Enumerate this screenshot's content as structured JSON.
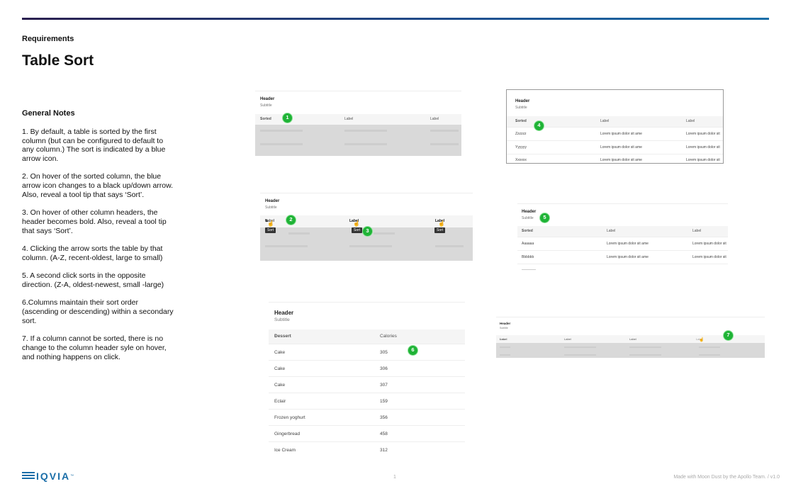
{
  "eyebrow": "Requirements",
  "title": "Table Sort",
  "notes": {
    "heading": "General Notes",
    "items": [
      "1. By default, a table is sorted by the first column (but can be configured to default to any column.) The sort is indicated by a blue arrow icon.",
      "2. On hover of the sorted column, the blue arrow icon changes to a black up/down arrow. Also, reveal a tool tip that says ‘Sort’.",
      "3. On hover of other column headers, the header becomes bold. Also, reveal a tool tip that says ‘Sort’.",
      "4. Clicking the arrow sorts the table by that column. (A-Z, recent-oldest, large to small)",
      "5. A second click sorts in the opposite direction. (Z-A, oldest-newest, small -large)",
      "6.Columns maintain their sort order (ascending or descending) within a secondary sort.",
      "7. If a column cannot be sorted, there is no change to the column header syle on hover, and nothing happens on click."
    ]
  },
  "common": {
    "header": "Header",
    "subtitle": "Subtitle",
    "sorted": "Sorted",
    "label": "Label",
    "sort_tip": "Sort",
    "lorem": "Lorem ipsum dolor sit ame",
    "lorem_trunc": "Lorem ipsum dolor sit",
    "arrow_up": "↑",
    "arrow_down": "↓",
    "arrow_updown": "⇅"
  },
  "panel4": {
    "rows": [
      "Zzzzzz",
      "Yyyyyy",
      "Xxxxxx"
    ]
  },
  "panel5": {
    "rows": [
      "Aaaaaa",
      "Bbbbbb"
    ]
  },
  "panel6": {
    "col1": "Dessert",
    "col2": "Calories",
    "rows": [
      {
        "name": "Cake",
        "cal": "305"
      },
      {
        "name": "Cake",
        "cal": "306"
      },
      {
        "name": "Cake",
        "cal": "307"
      },
      {
        "name": "Eclair",
        "cal": "159"
      },
      {
        "name": "Frozen yoghurt",
        "cal": "356"
      },
      {
        "name": "Gingerbread",
        "cal": "458"
      },
      {
        "name": "Ice Cream",
        "cal": "312"
      }
    ]
  },
  "badges": [
    "1",
    "2",
    "3",
    "4",
    "5",
    "6",
    "7"
  ],
  "footer": {
    "logo": "IQVIA",
    "logo_tm": "™",
    "page": "1",
    "credit": "Made with Moon Dust by the Apollo Team.  /  v1.0"
  },
  "colors": {
    "accent_blue": "#1a5fd0",
    "badge_green": "#1fb336",
    "brand": "#1a6ea8"
  },
  "icons": [
    "sort-up-arrow-icon",
    "sort-down-arrow-icon",
    "sort-updown-icon",
    "hand-cursor-icon",
    "iqvia-logo"
  ]
}
